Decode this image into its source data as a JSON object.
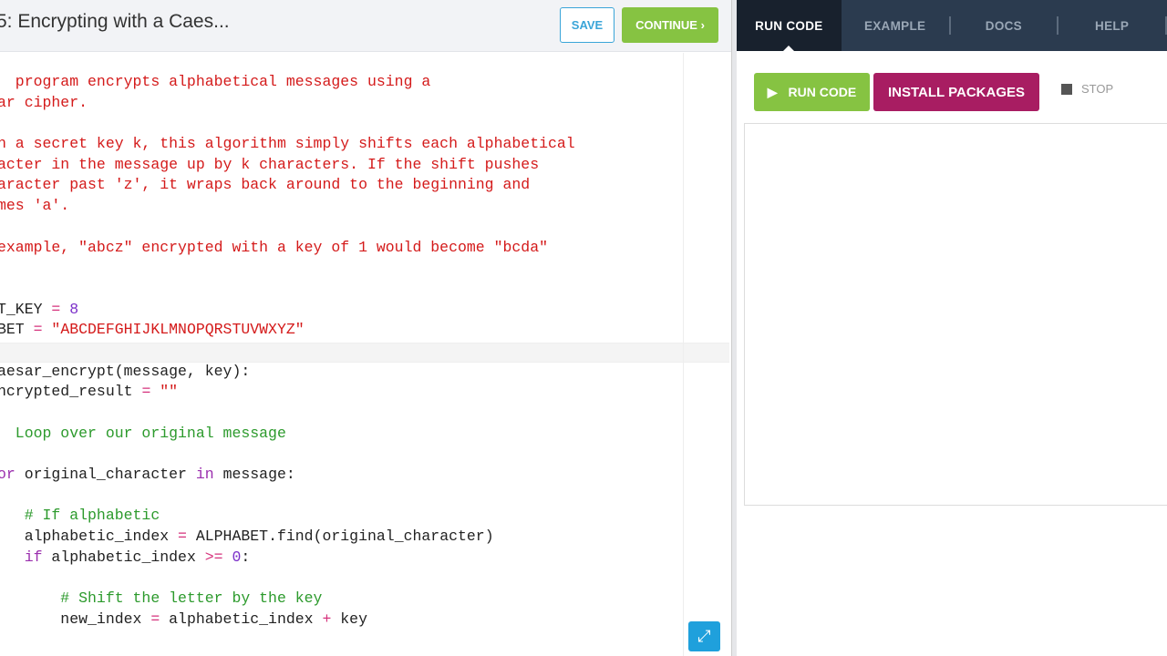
{
  "header": {
    "title": "5: Encrypting with a Caes...",
    "save_label": "SAVE",
    "continue_label": "CONTINUE ›"
  },
  "tabs": [
    {
      "label": "RUN CODE"
    },
    {
      "label": "EXAMPLE"
    },
    {
      "label": "DOCS"
    },
    {
      "label": "HELP"
    }
  ],
  "controls": {
    "run_label": "RUN CODE",
    "install_label": "INSTALL PACKAGES",
    "stop_label": "STOP"
  },
  "colors": {
    "docstring": "#d41a1a",
    "comment": "#2c9a2c",
    "keyword": "#9b2fae",
    "operator": "#d6337d",
    "string": "#d41a1a",
    "number": "#7b2fc9",
    "text": "#222222"
  },
  "code": [
    [
      {
        "t": "  program encrypts alphabetical messages using a",
        "c": "docstring"
      }
    ],
    [
      {
        "t": "ar cipher.",
        "c": "docstring"
      }
    ],
    [],
    [
      {
        "t": "n a secret key k, this algorithm simply shifts each alphabetical",
        "c": "docstring"
      }
    ],
    [
      {
        "t": "acter in the message up by k characters. If the shift pushes",
        "c": "docstring"
      }
    ],
    [
      {
        "t": "aracter past 'z', it wraps back around to the beginning and",
        "c": "docstring"
      }
    ],
    [
      {
        "t": "mes 'a'.",
        "c": "docstring"
      }
    ],
    [],
    [
      {
        "t": "example, \"abcz\" encrypted with a key of 1 would become \"bcda\"",
        "c": "docstring"
      }
    ],
    [],
    [],
    [
      {
        "t": "T_KEY ",
        "c": "text"
      },
      {
        "t": "=",
        "c": "operator"
      },
      {
        "t": " ",
        "c": "text"
      },
      {
        "t": "8",
        "c": "number"
      }
    ],
    [
      {
        "t": "BET ",
        "c": "text"
      },
      {
        "t": "=",
        "c": "operator"
      },
      {
        "t": " \"ABCDEFGHIJKLMNOPQRSTUVWXYZ\"",
        "c": "string"
      }
    ],
    [],
    [
      {
        "t": "aesar_encrypt(message, key):",
        "c": "text"
      }
    ],
    [
      {
        "t": "ncrypted_result ",
        "c": "text"
      },
      {
        "t": "=",
        "c": "operator"
      },
      {
        "t": " \"\"",
        "c": "string"
      }
    ],
    [],
    [
      {
        "t": "  Loop over our original message",
        "c": "comment"
      }
    ],
    [],
    [
      {
        "t": "or",
        "c": "keyword"
      },
      {
        "t": " original_character ",
        "c": "text"
      },
      {
        "t": "in",
        "c": "keyword"
      },
      {
        "t": " message:",
        "c": "text"
      }
    ],
    [],
    [
      {
        "t": "   # If alphabetic",
        "c": "comment"
      }
    ],
    [
      {
        "t": "   alphabetic_index ",
        "c": "text"
      },
      {
        "t": "=",
        "c": "operator"
      },
      {
        "t": " ALPHABET.find(original_character)",
        "c": "text"
      }
    ],
    [
      {
        "t": "   ",
        "c": "text"
      },
      {
        "t": "if",
        "c": "keyword"
      },
      {
        "t": " alphabetic_index ",
        "c": "text"
      },
      {
        "t": ">=",
        "c": "operator"
      },
      {
        "t": " ",
        "c": "text"
      },
      {
        "t": "0",
        "c": "number"
      },
      {
        "t": ":",
        "c": "text"
      }
    ],
    [],
    [
      {
        "t": "       # Shift the letter by the key",
        "c": "comment"
      }
    ],
    [
      {
        "t": "       new_index ",
        "c": "text"
      },
      {
        "t": "=",
        "c": "operator"
      },
      {
        "t": " alphabetic_index ",
        "c": "text"
      },
      {
        "t": "+",
        "c": "operator"
      },
      {
        "t": " key",
        "c": "text"
      }
    ]
  ]
}
